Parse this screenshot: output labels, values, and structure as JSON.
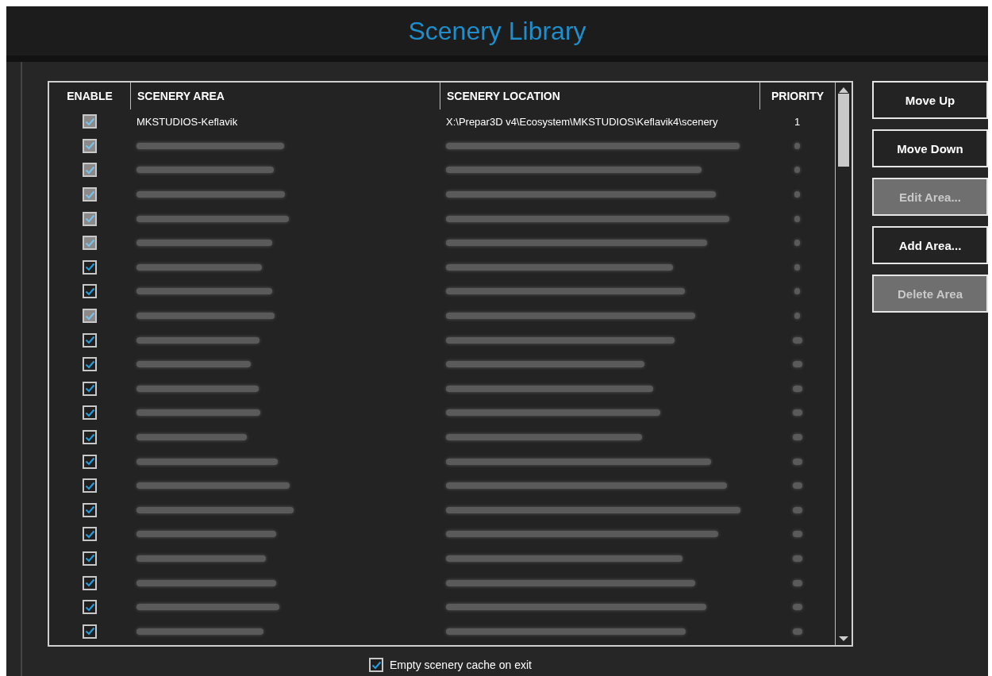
{
  "window": {
    "title": "Scenery Library"
  },
  "table": {
    "columns": [
      "ENABLE",
      "SCENERY AREA",
      "SCENERY LOCATION",
      "PRIORITY"
    ],
    "rows": [
      {
        "checked": true,
        "disabled": true,
        "area": "MKSTUDIOS-Keflavik",
        "location": "X:\\Prepar3D v4\\Ecosystem\\MKSTUDIOS\\Keflavik4\\scenery",
        "priority": "1"
      },
      {
        "checked": true,
        "disabled": true
      },
      {
        "checked": true,
        "disabled": true
      },
      {
        "checked": true,
        "disabled": true
      },
      {
        "checked": true,
        "disabled": true
      },
      {
        "checked": true,
        "disabled": true
      },
      {
        "checked": true,
        "disabled": false
      },
      {
        "checked": true,
        "disabled": false
      },
      {
        "checked": true,
        "disabled": true
      },
      {
        "checked": true,
        "disabled": false
      },
      {
        "checked": true,
        "disabled": false
      },
      {
        "checked": true,
        "disabled": false
      },
      {
        "checked": true,
        "disabled": false
      },
      {
        "checked": true,
        "disabled": false
      },
      {
        "checked": true,
        "disabled": false
      },
      {
        "checked": true,
        "disabled": false
      },
      {
        "checked": true,
        "disabled": false
      },
      {
        "checked": true,
        "disabled": false
      },
      {
        "checked": true,
        "disabled": false
      },
      {
        "checked": true,
        "disabled": false
      },
      {
        "checked": true,
        "disabled": false
      },
      {
        "checked": true,
        "disabled": false
      }
    ]
  },
  "buttons": [
    {
      "label": "Move Up",
      "disabled": false
    },
    {
      "label": "Move Down",
      "disabled": false
    },
    {
      "label": "Edit Area...",
      "disabled": true
    },
    {
      "label": "Add Area...",
      "disabled": false
    },
    {
      "label": "Delete Area",
      "disabled": true
    }
  ],
  "cache_option": {
    "label": "Empty scenery cache on exit",
    "checked": true
  }
}
